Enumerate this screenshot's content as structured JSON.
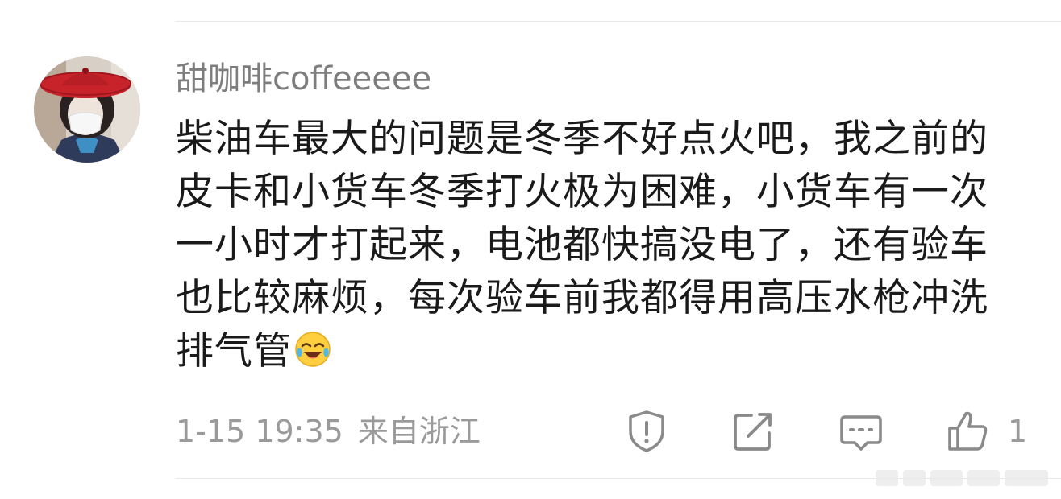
{
  "comment": {
    "username": "甜咖啡coffeeeee",
    "text": "柴油车最大的问题是冬季不好点火吧，我之前的皮卡和小货车冬季打火极为困难，小货车有一次一小时才打起来，电池都快搞没电了，还有验车也比较麻烦，每次验车前我都得用高压水枪冲洗排气管",
    "emoji": "laughing-crying-emoji",
    "timestamp": "1-15 19:35",
    "location": "来自浙江",
    "like_count": "1"
  },
  "actions": {
    "report_icon": "report-icon",
    "share_icon": "share-icon",
    "reply_icon": "reply-icon",
    "like_icon": "thumbs-up-icon"
  },
  "colors": {
    "username": "#7d7d7d",
    "text": "#1a1a1a",
    "meta": "#9a9a9a",
    "icon": "#8a8a8a",
    "divider": "#e8e8e8",
    "avatar_hat": "#c8232a"
  }
}
